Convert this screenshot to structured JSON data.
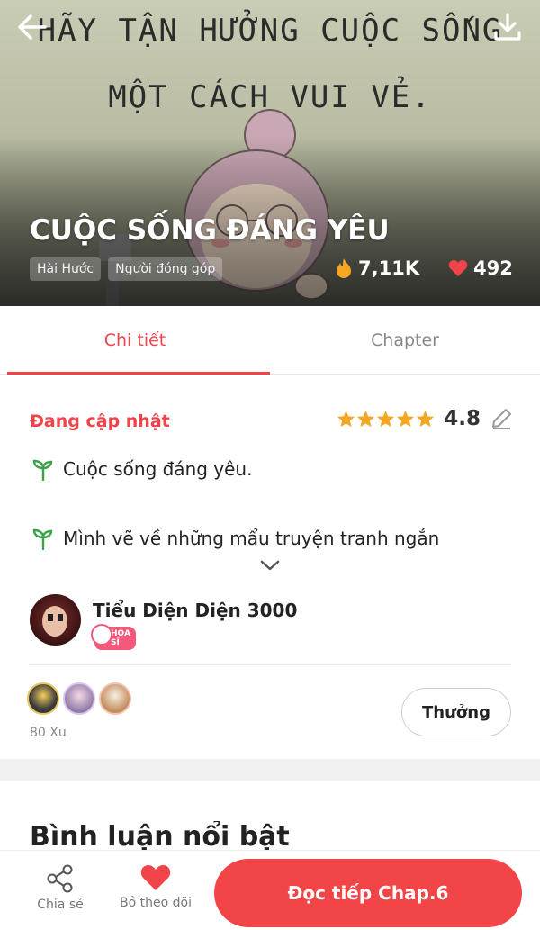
{
  "hero": {
    "comic_line_1": "HÃY TẬN HƯỞNG CUỘC SỐNG",
    "comic_line_2": "MỘT CÁCH VUI VẺ.",
    "title": "CUỘC SỐNG ĐÁNG YÊU",
    "tags": [
      "Hài Hước",
      "Người đóng góp"
    ],
    "views": "7,11K",
    "likes": "492"
  },
  "tabs": [
    {
      "label": "Chi tiết",
      "active": true
    },
    {
      "label": "Chapter",
      "active": false
    }
  ],
  "details": {
    "status": "Đang cập nhật",
    "rating": "4.8",
    "stars": 5,
    "description": [
      "Cuộc sống đáng yêu.",
      "Mình vẽ về những mẩu truyện tranh ngắn"
    ]
  },
  "author": {
    "name": "Tiểu Diện Diện 3000",
    "badge": "HỌA SĨ"
  },
  "support": {
    "coins": "80 Xu",
    "reward_label": "Thưởng"
  },
  "comments": {
    "title": "Bình luận nổi bật"
  },
  "bottom_bar": {
    "share_label": "Chia sẻ",
    "follow_label": "Bỏ theo dõi",
    "read_label": "Đọc tiếp Chap.6"
  },
  "colors": {
    "accent": "#f0444a",
    "read_button": "#f24548",
    "star": "#f5a623"
  }
}
